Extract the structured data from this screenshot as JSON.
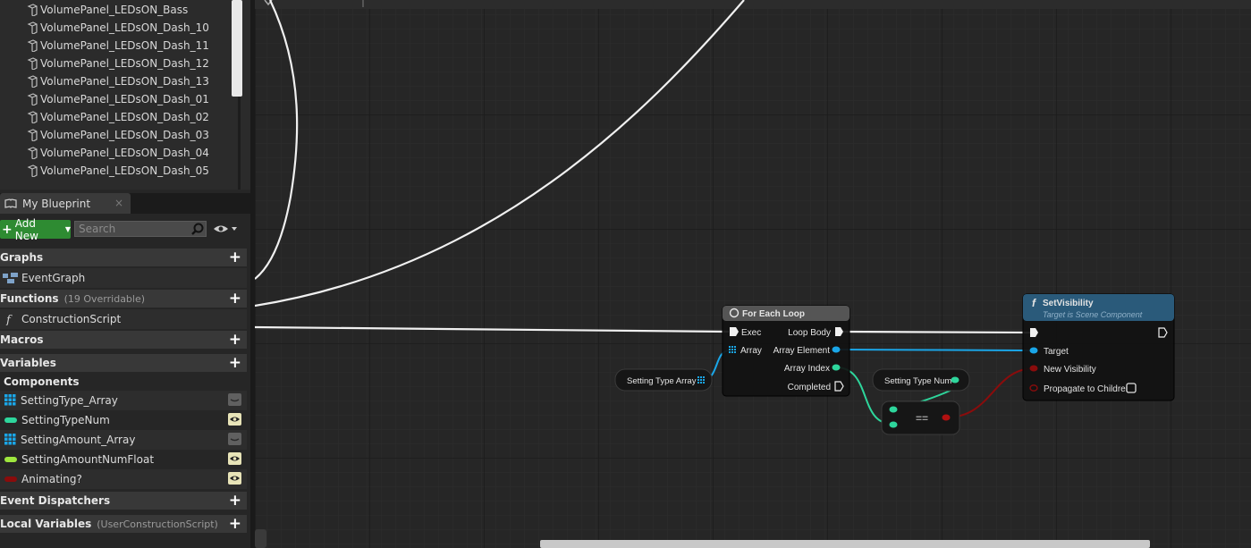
{
  "tree": {
    "items": [
      "VolumePanel_LEDsON_Bass",
      "VolumePanel_LEDsON_Dash_10",
      "VolumePanel_LEDsON_Dash_11",
      "VolumePanel_LEDsON_Dash_12",
      "VolumePanel_LEDsON_Dash_13",
      "VolumePanel_LEDsON_Dash_01",
      "VolumePanel_LEDsON_Dash_02",
      "VolumePanel_LEDsON_Dash_03",
      "VolumePanel_LEDsON_Dash_04",
      "VolumePanel_LEDsON_Dash_05"
    ]
  },
  "panel": {
    "tab_label": "My Blueprint",
    "close": "×",
    "add_new": "Add New",
    "search_placeholder": "Search"
  },
  "sections": {
    "graphs": "Graphs",
    "event_graph": "EventGraph",
    "functions": "Functions",
    "functions_sub": "(19 Overridable)",
    "construction_script": "ConstructionScript",
    "macros": "Macros",
    "variables": "Variables",
    "components": "Components",
    "event_dispatchers": "Event Dispatchers",
    "local_variables": "Local Variables",
    "local_variables_sub": "(UserConstructionScript)"
  },
  "variables": [
    {
      "name": "SettingType_Array",
      "color": "#1aa6e8",
      "kind": "array",
      "visible": false
    },
    {
      "name": "SettingTypeNum",
      "color": "#2ed69c",
      "kind": "pill",
      "visible": true
    },
    {
      "name": "SettingAmount_Array",
      "color": "#1aa6e8",
      "kind": "array",
      "visible": false
    },
    {
      "name": "SettingAmountNumFloat",
      "color": "#9ee63e",
      "kind": "pill",
      "visible": true
    },
    {
      "name": "Animating?",
      "color": "#8a0c0c",
      "kind": "pill",
      "visible": true
    }
  ],
  "graph": {
    "for_each": {
      "title": "For Each Loop",
      "exec": "Exec",
      "array": "Array",
      "loop_body": "Loop Body",
      "array_element": "Array Element",
      "array_index": "Array Index",
      "completed": "Completed"
    },
    "set_visibility": {
      "title": "SetVisibility",
      "subtitle": "Target is Scene Component",
      "target": "Target",
      "new_visibility": "New Visibility",
      "propagate": "Propagate to Children"
    },
    "setting_type_array": "Setting Type Array",
    "setting_type_num": "Setting Type Num",
    "equals": "=="
  },
  "colors": {
    "exec_wire": "#f0f0f0",
    "int_pin": "#2ed69c",
    "object_pin": "#1aa6e8",
    "bool_pin": "#8a0c0c",
    "add_new": "#2e8b32",
    "function_header": "#2a5a7a"
  }
}
